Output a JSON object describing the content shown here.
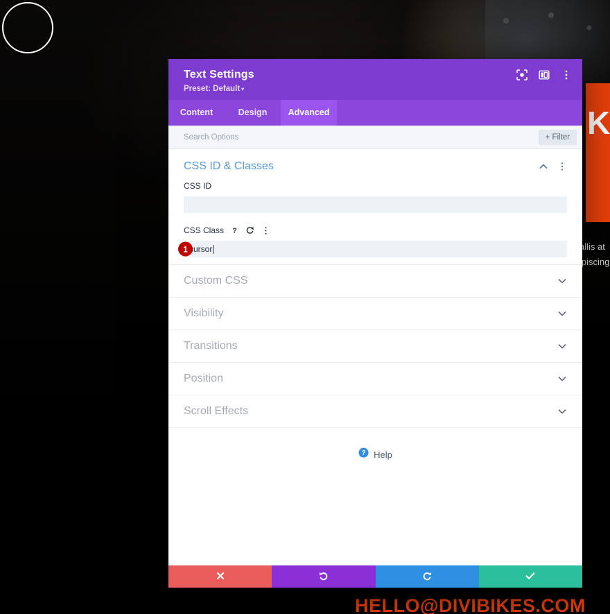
{
  "background": {
    "hero_circle": "decorative-circle",
    "right_headline_fragment": "KE",
    "right_body_lines": [
      "allis at",
      "ipiscing"
    ],
    "footer_email": "HELLO@DIVIBIKES.COM"
  },
  "modal": {
    "title": "Text Settings",
    "preset_label": "Preset: Default",
    "preset_caret": "▾",
    "header_icons": [
      {
        "name": "focus-target-icon",
        "title": "Focus"
      },
      {
        "name": "layout-columns-icon",
        "title": "Layout"
      },
      {
        "name": "more-vertical-icon",
        "title": "More options"
      }
    ],
    "tabs": [
      {
        "label": "Content",
        "active": false
      },
      {
        "label": "Design",
        "active": false
      },
      {
        "label": "Advanced",
        "active": true
      }
    ],
    "search": {
      "placeholder": "Search Options",
      "value": ""
    },
    "filter_button": "+ Filter",
    "open_section": {
      "title": "CSS ID & Classes",
      "collapse_icon": "chevron-up-icon",
      "menu_icon": "more-vertical-icon",
      "fields": [
        {
          "label": "CSS ID",
          "value": "",
          "placeholder": "",
          "icons": []
        },
        {
          "label": "CSS Class",
          "value": "cursor",
          "placeholder": "",
          "icons": [
            "help-icon",
            "reset-icon",
            "more-vertical-icon"
          ],
          "step_badge": "1"
        }
      ]
    },
    "collapsed_sections": [
      {
        "title": "Custom CSS"
      },
      {
        "title": "Visibility"
      },
      {
        "title": "Transitions"
      },
      {
        "title": "Position"
      },
      {
        "title": "Scroll Effects"
      }
    ],
    "help": {
      "icon": "help-circle-icon",
      "label": "Help"
    },
    "actions": [
      {
        "name": "cancel-button",
        "icon": "close-icon",
        "color": "#eb5c5c"
      },
      {
        "name": "undo-button",
        "icon": "undo-icon",
        "color": "#8b2fd6"
      },
      {
        "name": "redo-button",
        "icon": "redo-icon",
        "color": "#2e8fe0"
      },
      {
        "name": "save-button",
        "icon": "check-icon",
        "color": "#2bbf9b"
      }
    ]
  },
  "colors": {
    "header_purple": "#7e3bd0",
    "tab_purple": "#8b47da",
    "tab_active_purple": "#9b55ef",
    "section_title_blue": "#5a9ad6",
    "badge_red": "#c00000",
    "brand_orange": "#e8400b"
  }
}
